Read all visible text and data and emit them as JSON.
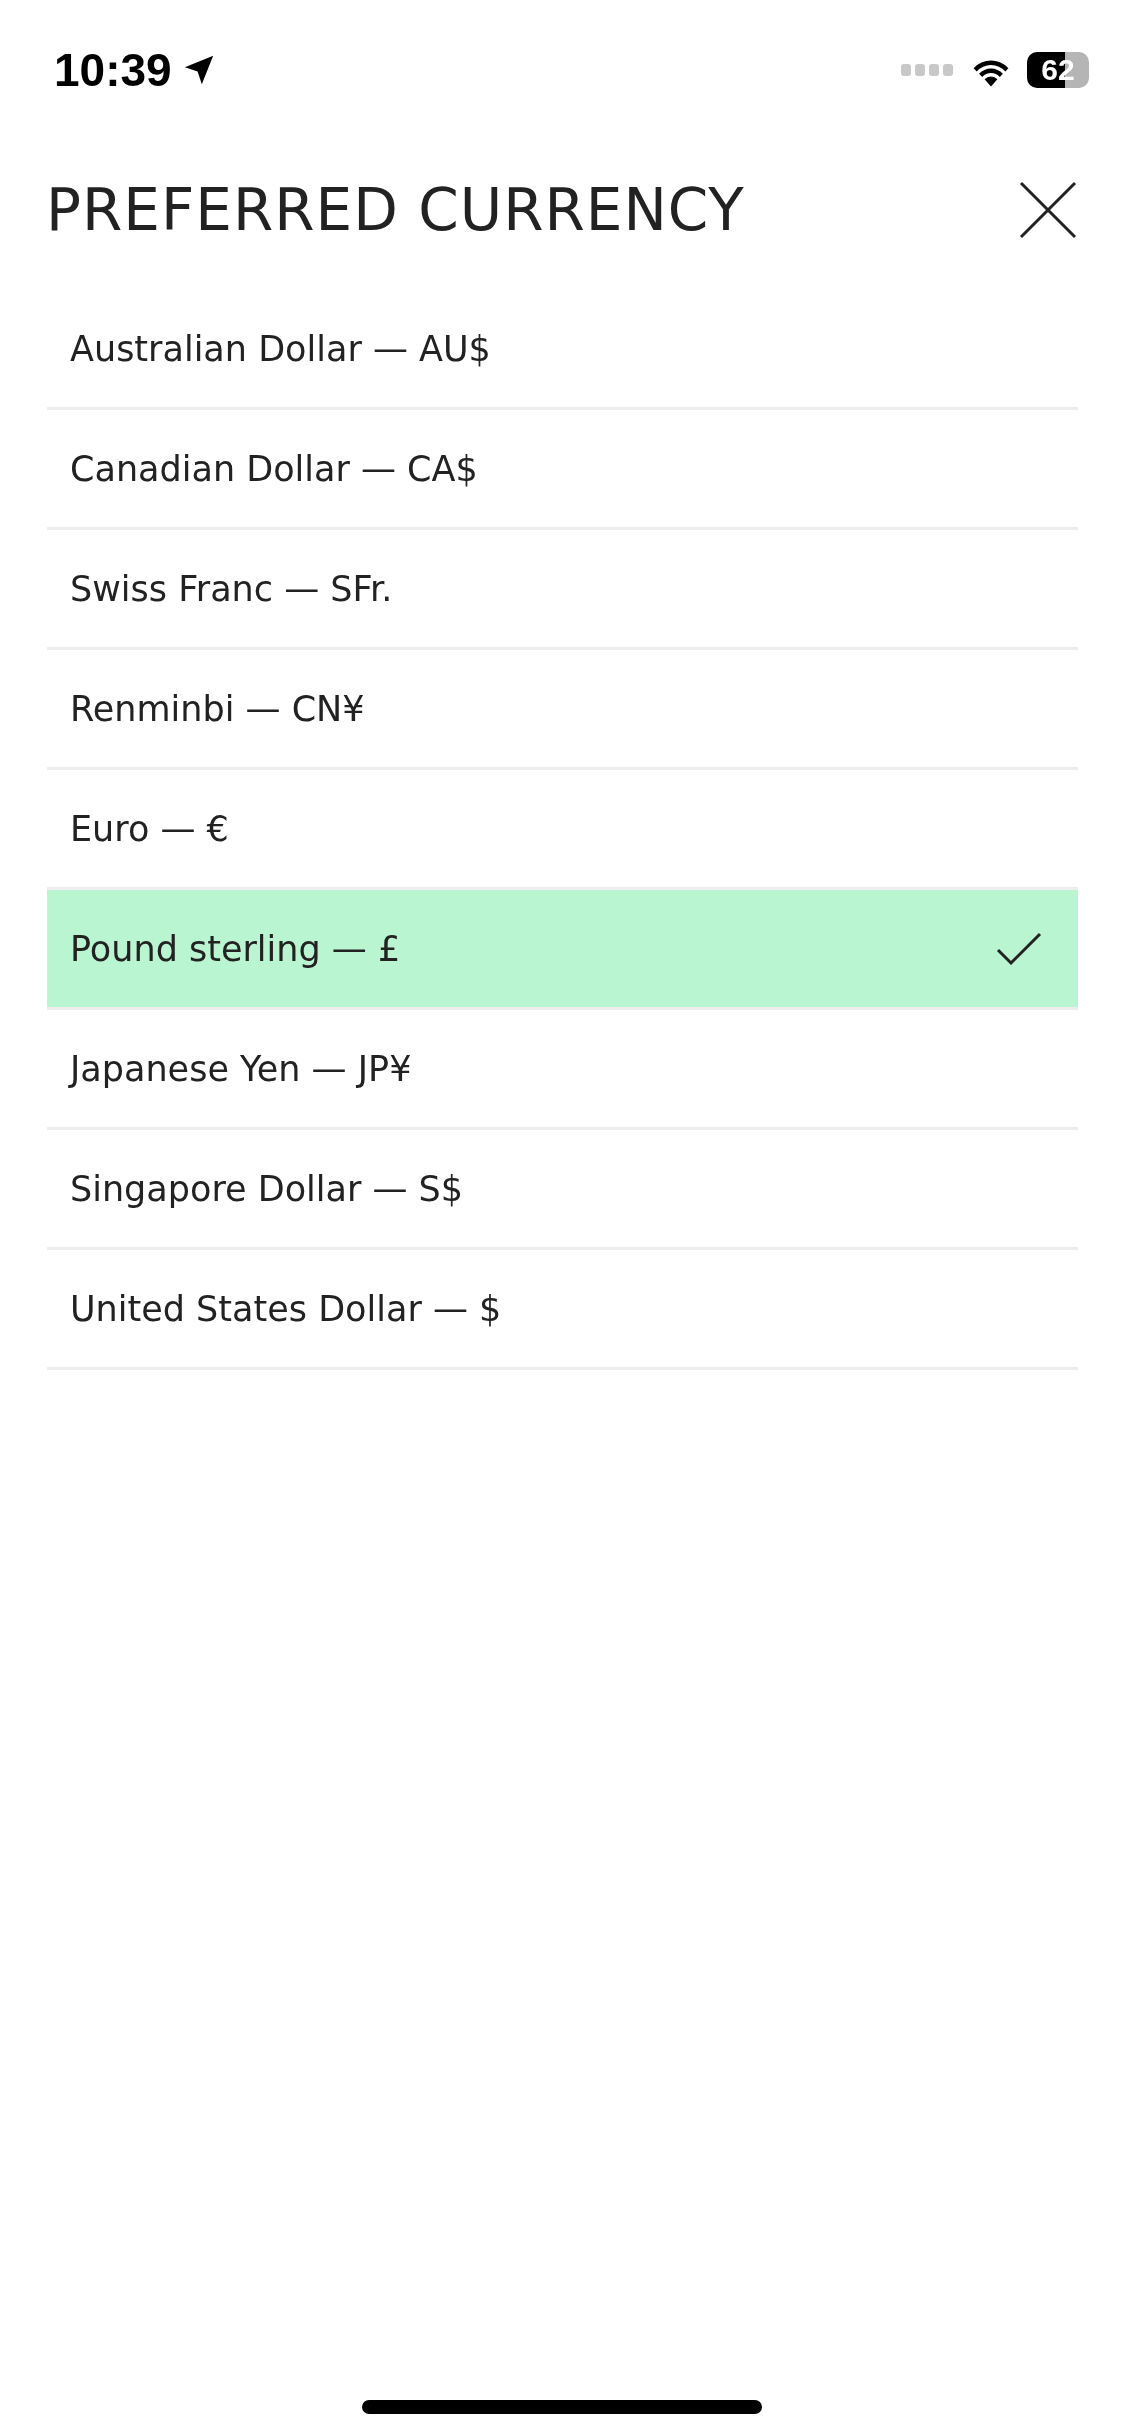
{
  "status_bar": {
    "time": "10:39",
    "battery": "62"
  },
  "header": {
    "title": "PREFERRED CURRENCY"
  },
  "currencies": [
    {
      "label": "Australian Dollar — AU$",
      "selected": false
    },
    {
      "label": "Canadian Dollar — CA$",
      "selected": false
    },
    {
      "label": "Swiss Franc — SFr.",
      "selected": false
    },
    {
      "label": "Renminbi — CN¥",
      "selected": false
    },
    {
      "label": "Euro — €",
      "selected": false
    },
    {
      "label": "Pound sterling — £",
      "selected": true
    },
    {
      "label": "Japanese Yen — JP¥",
      "selected": false
    },
    {
      "label": "Singapore Dollar — S$",
      "selected": false
    },
    {
      "label": "United States Dollar — $",
      "selected": false
    }
  ]
}
